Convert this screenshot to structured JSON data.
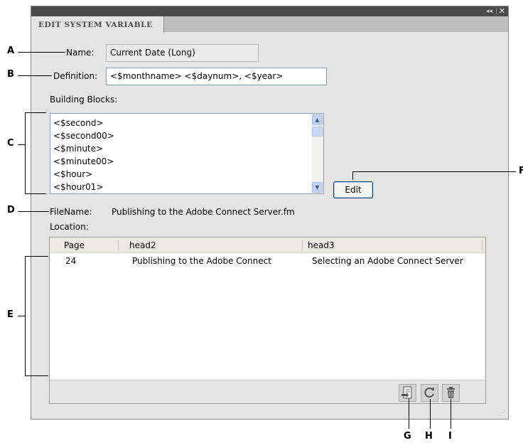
{
  "panel": {
    "tab_title": "EDIT SYSTEM VARIABLE",
    "collapse_glyph": "◂◂",
    "separator": "|",
    "close_glyph": "✕"
  },
  "form": {
    "name_label": "Name:",
    "name_value": "Current Date (Long)",
    "definition_label": "Definition:",
    "definition_value": "<$monthname> <$daynum>, <$year>",
    "building_blocks_label": "Building Blocks:",
    "building_blocks": [
      "<$second>",
      "<$second00>",
      "<$minute>",
      "<$minute00>",
      "<$hour>",
      "<$hour01>"
    ],
    "edit_button": "Edit",
    "filename_label": "FileName:",
    "filename_value": "Publishing to the Adobe Connect Server.fm",
    "location_label": "Location:"
  },
  "table": {
    "columns": [
      "Page",
      "head2",
      "head3"
    ],
    "rows": [
      [
        "24",
        "Publishing to the Adobe Connect",
        "Selecting an Adobe Connect Server"
      ]
    ]
  },
  "toolbar_icons": [
    "go-to-source-icon",
    "update-icon",
    "delete-icon"
  ],
  "callouts": {
    "a": "A",
    "b": "B",
    "c": "C",
    "d": "D",
    "e": "E",
    "f": "F",
    "g": "G",
    "h": "H",
    "i": "I"
  }
}
